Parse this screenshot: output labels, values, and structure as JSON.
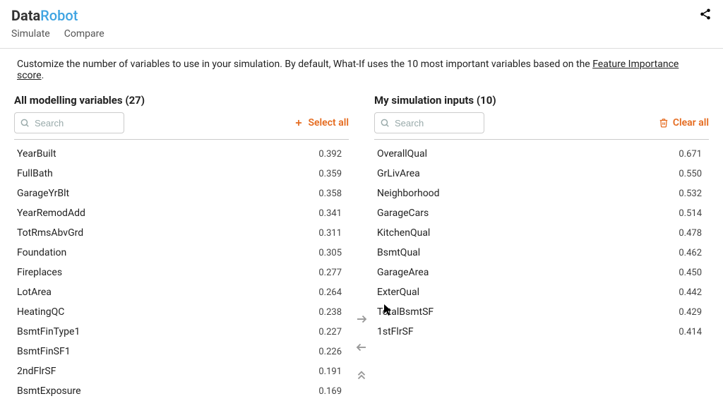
{
  "brand": {
    "part1": "Data",
    "part2": "Robot"
  },
  "tabs": {
    "simulate": "Simulate",
    "compare": "Compare"
  },
  "description": {
    "text_before": "Customize the number of variables to use in your simulation. By default, What-If uses the 10 most important variables based on the ",
    "link_text": "Feature Importance score",
    "text_after": "."
  },
  "left_panel": {
    "title_prefix": "All modelling variables",
    "count": "(27)",
    "search_placeholder": "Search",
    "select_all": "Select all",
    "rows": [
      {
        "name": "YearBuilt",
        "value": "0.392"
      },
      {
        "name": "FullBath",
        "value": "0.359"
      },
      {
        "name": "GarageYrBlt",
        "value": "0.358"
      },
      {
        "name": "YearRemodAdd",
        "value": "0.341"
      },
      {
        "name": "TotRmsAbvGrd",
        "value": "0.311"
      },
      {
        "name": "Foundation",
        "value": "0.305"
      },
      {
        "name": "Fireplaces",
        "value": "0.277"
      },
      {
        "name": "LotArea",
        "value": "0.264"
      },
      {
        "name": "HeatingQC",
        "value": "0.238"
      },
      {
        "name": "BsmtFinType1",
        "value": "0.227"
      },
      {
        "name": "BsmtFinSF1",
        "value": "0.226"
      },
      {
        "name": "2ndFlrSF",
        "value": "0.191"
      },
      {
        "name": "BsmtExposure",
        "value": "0.169"
      }
    ]
  },
  "right_panel": {
    "title_prefix": "My simulation inputs",
    "count": "(10)",
    "search_placeholder": "Search",
    "clear_all": "Clear all",
    "rows": [
      {
        "name": "OverallQual",
        "value": "0.671"
      },
      {
        "name": "GrLivArea",
        "value": "0.550"
      },
      {
        "name": "Neighborhood",
        "value": "0.532"
      },
      {
        "name": "GarageCars",
        "value": "0.514"
      },
      {
        "name": "KitchenQual",
        "value": "0.478"
      },
      {
        "name": "BsmtQual",
        "value": "0.462"
      },
      {
        "name": "GarageArea",
        "value": "0.450"
      },
      {
        "name": "ExterQual",
        "value": "0.442"
      },
      {
        "name": "TotalBsmtSF",
        "value": "0.429"
      },
      {
        "name": "1stFlrSF",
        "value": "0.414"
      }
    ]
  }
}
